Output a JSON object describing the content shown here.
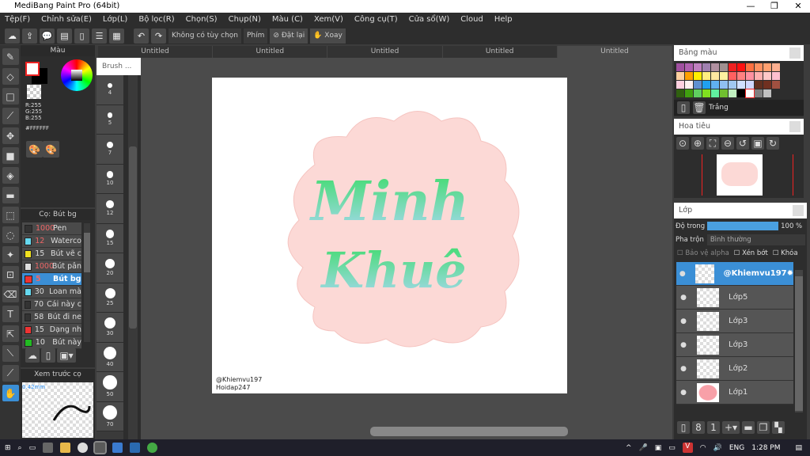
{
  "window": {
    "title": "MediBang Paint Pro (64bit)"
  },
  "menu": [
    "Tệp(F)",
    "Chỉnh sửa(E)",
    "Lớp(L)",
    "Bộ lọc(R)",
    "Chọn(S)",
    "Chụp(N)",
    "Màu (C)",
    "Xem(V)",
    "Công cụ(T)",
    "Cửa sổ(W)",
    "Cloud",
    "Help"
  ],
  "toolbar": {
    "no_option": "Không có tùy chọn",
    "key_label": "Phím",
    "reset": "Đặt lại",
    "rotate": "Xoay"
  },
  "tabs": [
    "Untitled",
    "Untitled",
    "Untitled",
    "Untitled",
    "Untitled"
  ],
  "color_panel": {
    "title": "Màu",
    "r": "R:255",
    "g": "G:255",
    "b": "B:255",
    "hex": "#FFFFFF",
    "fg": "#FFFFFF",
    "bg": "#000000"
  },
  "brush_panel": {
    "title": "Cọ: Bút bg",
    "size_title": "Brush ...",
    "items": [
      {
        "size": "1000",
        "name": "Pen",
        "color": "#333333"
      },
      {
        "size": "12",
        "name": "Waterco",
        "color": "#66d9f0"
      },
      {
        "size": "15",
        "name": "Bút vẽ c",
        "color": "#f0e020"
      },
      {
        "size": "1000",
        "name": "Bút pân",
        "color": "#dddddd"
      },
      {
        "size": "5",
        "name": "Bút bg",
        "color": "#ee3333",
        "selected": true
      },
      {
        "size": "30",
        "name": "Loan mà",
        "color": "#66d9f0"
      },
      {
        "size": "70",
        "name": "Cái này c",
        "color": "#333333"
      },
      {
        "size": "58",
        "name": "Bút đi ne",
        "color": "#333333"
      },
      {
        "size": "15",
        "name": "Dạng nh",
        "color": "#ee3333"
      },
      {
        "size": "10",
        "name": "Bút này",
        "color": "#22bb22"
      }
    ],
    "sizes": [
      "4",
      "5",
      "7",
      "10",
      "12",
      "15",
      "20",
      "25",
      "30",
      "40",
      "50",
      "70"
    ]
  },
  "preview": {
    "title": "Xem trước cọ",
    "size": "0.42mm"
  },
  "palette": {
    "title": "Bảng màu",
    "selected_name": "Trắng",
    "colors": [
      "#a050a0",
      "#b060b0",
      "#c080c0",
      "#a080b0",
      "#b090a0",
      "#a09090",
      "#ee2020",
      "#ff1010",
      "#ff7040",
      "#ff9060",
      "#ffa070",
      "#ffb090",
      "#ffd0a0",
      "#ffa000",
      "#ffee00",
      "#ffee80",
      "#ffe8a0",
      "#fff0a0",
      "#ff6060",
      "#ff8080",
      "#ff90a0",
      "#ffb0b0",
      "#ffc8c8",
      "#ffc0d0",
      "#ffd0e0",
      "#fff0f0",
      "#6090d0",
      "#20a0f0",
      "#60b0f0",
      "#90c0f0",
      "#a0c8f0",
      "#d0e0ff",
      "#d0d8ff",
      "#603020",
      "#703020",
      "#a05040",
      "#306010",
      "#40a010",
      "#60d060",
      "#80e020",
      "#60f0a0",
      "#70c030",
      "#c0f0c0",
      "#000000",
      "#ffffff",
      "#808080",
      "#c0c0c0"
    ]
  },
  "navigator": {
    "title": "Hoa tiêu"
  },
  "layers": {
    "title": "Lớp",
    "opacity_label": "Độ trong",
    "opacity": "100 %",
    "opacity_value": 100,
    "blend_label": "Pha trộn",
    "blend": "Bình thường",
    "protect_alpha": "Bảo vệ alpha",
    "clip": "Xén bớt",
    "lock": "Khóa",
    "items": [
      {
        "name": "@Khiemvu197",
        "selected": true
      },
      {
        "name": "Lớp5"
      },
      {
        "name": "Lớp3"
      },
      {
        "name": "Lớp3"
      },
      {
        "name": "Lớp2"
      },
      {
        "name": "Lớp1"
      }
    ]
  },
  "canvas": {
    "text1": "Minh",
    "text2": "Khuê",
    "credit1": "@Khiemvu197",
    "credit2": "Hoidap247"
  },
  "taskbar": {
    "lang": "ENG",
    "time": "1:28 PM"
  }
}
